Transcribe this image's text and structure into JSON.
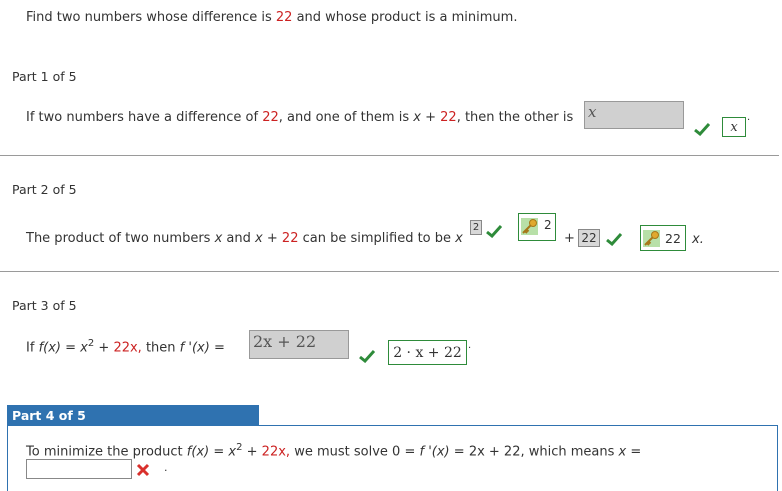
{
  "question": {
    "prefix": "Find two numbers whose difference is",
    "diff": "22",
    "suffix": "and whose product is a minimum."
  },
  "part1": {
    "header": "Part 1 of 5",
    "p1": "If two numbers have a difference of",
    "n1": "22",
    "p2": ", and one of them is",
    "x": "x",
    "plus": "+",
    "n2": "22",
    "p3": ", then the other is",
    "input_value": "x",
    "key_answer": "x",
    "period": "."
  },
  "part2": {
    "header": "Part 2 of 5",
    "p1": "The product of two numbers",
    "x1": "x",
    "and": "and",
    "x2": "x",
    "plus": "+",
    "n": "22",
    "p2": "can be simplified to be",
    "xvar": "x",
    "exp_input": "2",
    "key_exp": "2",
    "plus2": "+",
    "coef_input": "22",
    "key_coef": "22",
    "x_end": "x."
  },
  "part3": {
    "header": "Part 3 of 5",
    "if": "If",
    "fx": "f(x)",
    "eq": "=",
    "x2": "x",
    "sup": "2",
    "plus": "+",
    "coef": "22x,",
    "then": "then",
    "fpx": "f '(x)",
    "eq2": "=",
    "input_value": "2x + 22",
    "key_answer": "2 · x + 22",
    "period": "."
  },
  "part4": {
    "header": "Part 4 of 5",
    "p1": "To minimize the product",
    "fx": "f(x)",
    "eq": "=",
    "x2": "x",
    "sup": "2",
    "plus": "+",
    "coef": "22x,",
    "p2": "we must solve",
    "zero": "0",
    "eq2": "=",
    "fpx": "f '(x)",
    "eq3": "=",
    "rhs": "2x + 22,",
    "p3": "which means",
    "x": "x",
    "eq4": "=",
    "input_value": "",
    "period": "."
  },
  "colors": {
    "accent_blue": "#2f72b0",
    "number_red": "#cc2222",
    "check_green": "#2e8b3a",
    "wrong_red": "#d9302c"
  }
}
